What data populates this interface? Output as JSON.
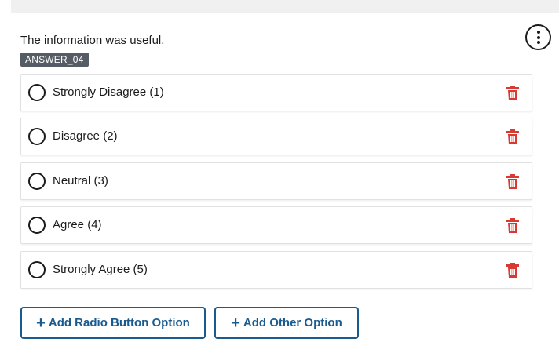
{
  "question": {
    "text": "The information was useful.",
    "tag": "ANSWER_04"
  },
  "menu": {
    "icon": "kebab-vertical-icon"
  },
  "options": [
    {
      "label": "Strongly Disagree (1)"
    },
    {
      "label": "Disagree (2)"
    },
    {
      "label": "Neutral (3)"
    },
    {
      "label": "Agree (4)"
    },
    {
      "label": "Strongly Agree (5)"
    }
  ],
  "actions": {
    "add_radio_label": "Add Radio Button Option",
    "add_other_label": "Add Other Option",
    "plus_glyph": "+"
  },
  "colors": {
    "accent": "#1a5b8f",
    "delete": "#d83933",
    "tag_bg": "#565c65"
  }
}
